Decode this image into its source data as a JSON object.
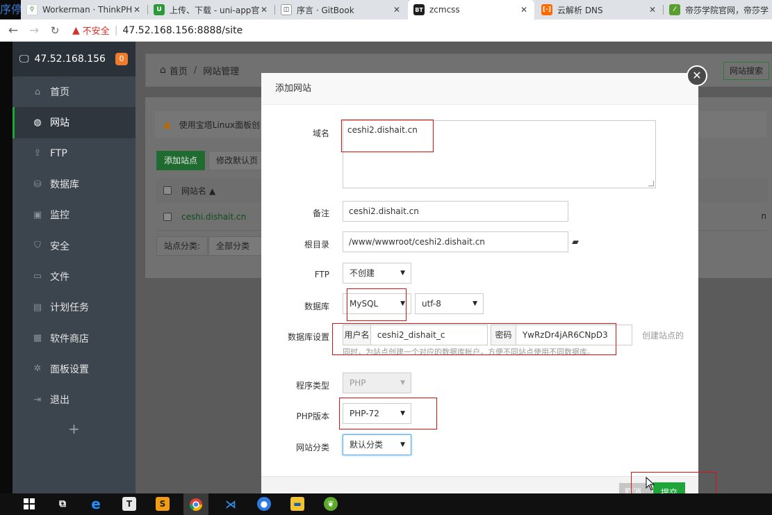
{
  "browser": {
    "left_fragment": "序停",
    "tabs": [
      {
        "title": "Workerman · ThinkPHP",
        "icon": "workerman-icon",
        "active": false
      },
      {
        "title": "上传、下载 - uni-app官网",
        "icon": "uniapp-icon",
        "active": false
      },
      {
        "title": "序言 · GitBook",
        "icon": "book-icon",
        "active": false
      },
      {
        "title": "zcmcss",
        "icon": "bt-icon",
        "active": true
      },
      {
        "title": "云解析 DNS",
        "icon": "aliyun-icon",
        "active": false
      },
      {
        "title": "帝莎学院官网，帝莎学",
        "icon": "disha-icon",
        "active": false
      }
    ],
    "insecure_label": "不安全",
    "url": "47.52.168.156:8888/site"
  },
  "sidebar": {
    "server_ip": "47.52.168.156",
    "badge": "0",
    "items": [
      {
        "label": "首页",
        "icon": "home-icon",
        "glyph": "⌂",
        "active": false
      },
      {
        "label": "网站",
        "icon": "globe-icon",
        "glyph": "◍",
        "active": true
      },
      {
        "label": "FTP",
        "icon": "ftp-icon",
        "glyph": "⇪",
        "active": false
      },
      {
        "label": "数据库",
        "icon": "database-icon",
        "glyph": "⛁",
        "active": false
      },
      {
        "label": "监控",
        "icon": "monitor-icon",
        "glyph": "▣",
        "active": false
      },
      {
        "label": "安全",
        "icon": "shield-icon",
        "glyph": "⛉",
        "active": false
      },
      {
        "label": "文件",
        "icon": "folder-icon",
        "glyph": "▭",
        "active": false
      },
      {
        "label": "计划任务",
        "icon": "calendar-icon",
        "glyph": "▤",
        "active": false
      },
      {
        "label": "软件商店",
        "icon": "apps-icon",
        "glyph": "▦",
        "active": false
      },
      {
        "label": "面板设置",
        "icon": "gear-icon",
        "glyph": "✲",
        "active": false
      },
      {
        "label": "退出",
        "icon": "logout-icon",
        "glyph": "⇥",
        "active": false
      }
    ],
    "plus": "+"
  },
  "main": {
    "breadcrumb_home": "首页",
    "breadcrumb_sep": "/",
    "breadcrumb_current": "网站管理",
    "search_button": "网站搜索",
    "alert": "使用宝塔Linux面板创",
    "add_site_button": "添加站点",
    "modify_default_button": "修改默认页",
    "table_header": "网站名 ▲",
    "table_row_site": "ceshi.dishait.cn",
    "table_row_tail": "n",
    "filter_label": "站点分类:",
    "filter_value": "全部分类"
  },
  "modal": {
    "title": "添加网站",
    "domain_label": "域名",
    "domain_value": "ceshi2.dishait.cn",
    "remark_label": "备注",
    "remark_value": "ceshi2.dishait.cn",
    "root_label": "根目录",
    "root_value": "/www/wwwroot/ceshi2.dishait.cn",
    "ftp_label": "FTP",
    "ftp_value": "不创建",
    "db_label": "数据库",
    "db_value": "MySQL",
    "charset_value": "utf-8",
    "db_settings_label": "数据库设置",
    "db_user_label": "用户名",
    "db_user_value": "ceshi2_dishait_c",
    "db_pass_label": "密码",
    "db_pass_value": "YwRzDr4jAR6CNpD3",
    "db_side_hint": "创建站点的",
    "db_hint": "同时，为站点创建一个对应的数据库帐户，方便不同站点使用不同数据库。",
    "program_label": "程序类型",
    "program_value": "PHP",
    "php_label": "PHP版本",
    "php_value": "PHP-72",
    "category_label": "网站分类",
    "category_value": "默认分类",
    "cancel_button": "取消",
    "submit_button": "提交",
    "close_glyph": "✕"
  },
  "taskbar": {
    "icons": [
      "windows-start-icon",
      "task-view-icon",
      "ie-icon",
      "typora-icon",
      "sublime-icon",
      "chrome-icon",
      "vscode-icon",
      "camera-icon",
      "explorer-icon",
      "app-icon"
    ]
  }
}
